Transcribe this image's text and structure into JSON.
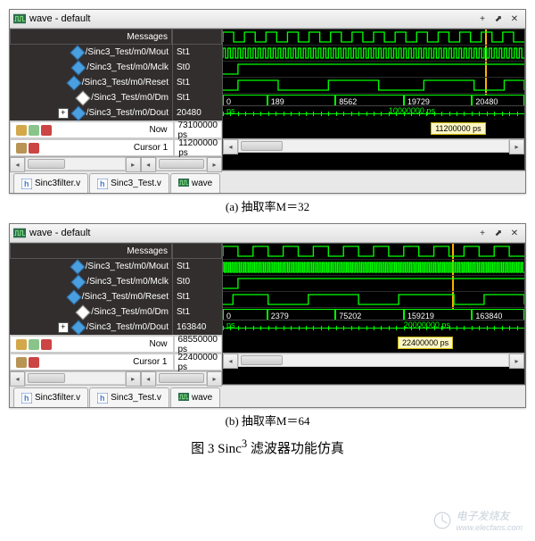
{
  "panels": [
    {
      "title": "wave - default",
      "header": "Messages",
      "signals": [
        {
          "name": "/Sinc3_Test/m0/Mout",
          "value": "St1",
          "icon": "blue"
        },
        {
          "name": "/Sinc3_Test/m0/Mclk",
          "value": "St0",
          "icon": "blue"
        },
        {
          "name": "/Sinc3_Test/m0/Reset",
          "value": "St1",
          "icon": "blue"
        },
        {
          "name": "/Sinc3_Test/m0/Dm",
          "value": "St1",
          "icon": "white"
        },
        {
          "name": "/Sinc3_Test/m0/Dout",
          "value": "20480",
          "icon": "blue",
          "expandable": true
        }
      ],
      "bus_values": [
        "0",
        "189",
        "8562",
        "19729",
        "20480"
      ],
      "now_label": "Now",
      "now_value": "73100000 ps",
      "cursor_label": "Cursor 1",
      "cursor_value": "11200000 ps",
      "ruler_start": "ps",
      "ruler_mid": "10000000 ps",
      "cursor_box": "11200000 ps",
      "tabs": [
        "Sinc3filter.v",
        "Sinc3_Test.v",
        "wave"
      ],
      "subcaption": "(a) 抽取率M＝32"
    },
    {
      "title": "wave - default",
      "header": "Messages",
      "signals": [
        {
          "name": "/Sinc3_Test/m0/Mout",
          "value": "St1",
          "icon": "blue"
        },
        {
          "name": "/Sinc3_Test/m0/Mclk",
          "value": "St0",
          "icon": "blue"
        },
        {
          "name": "/Sinc3_Test/m0/Reset",
          "value": "St1",
          "icon": "blue"
        },
        {
          "name": "/Sinc3_Test/m0/Dm",
          "value": "St1",
          "icon": "white"
        },
        {
          "name": "/Sinc3_Test/m0/Dout",
          "value": "163840",
          "icon": "blue",
          "expandable": true
        }
      ],
      "bus_values": [
        "0",
        "2379",
        "75202",
        "159219",
        "163840"
      ],
      "now_label": "Now",
      "now_value": "68550000 ps",
      "cursor_label": "Cursor 1",
      "cursor_value": "22400000 ps",
      "ruler_start": "ps",
      "ruler_mid": "20000000 ps",
      "cursor_box": "22400000 ps",
      "tabs": [
        "Sinc3filter.v",
        "Sinc3_Test.v",
        "wave"
      ],
      "subcaption": "(b) 抽取率M＝64"
    }
  ],
  "caption": "图 3 Sinc³ 滤波器功能仿真",
  "watermark": {
    "site": "电子发烧友",
    "url": "www.elecfans.com"
  }
}
